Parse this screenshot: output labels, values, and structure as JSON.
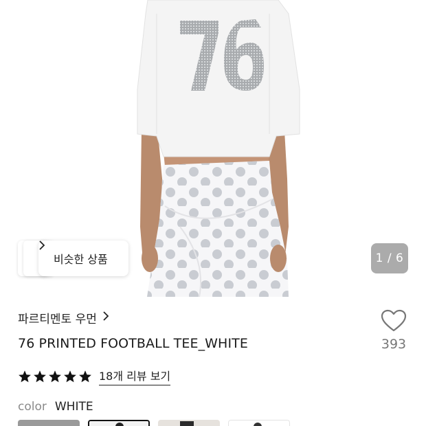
{
  "product_image": {
    "jersey_number": "76"
  },
  "similar": {
    "label": "비슷한 상품",
    "chevron": "chevron-right-icon"
  },
  "gallery": {
    "counter": "1 / 6"
  },
  "product": {
    "brand": "파르티멘토 우먼",
    "title": "76 PRINTED FOOTBALL TEE_WHITE"
  },
  "like": {
    "icon": "heart-outline-icon",
    "count": "393"
  },
  "rating": {
    "stars": 5,
    "review_link": "18개 리뷰 보기"
  },
  "color": {
    "label": "color",
    "value": "WHITE"
  },
  "colors": {
    "star": "#111111",
    "counter_bg": "#7a7a7a",
    "heart_stroke": "#777777"
  },
  "swatches": [
    {
      "name": "gray",
      "color": "#9a9a9a",
      "selected": false
    },
    {
      "name": "white",
      "color": "#f2f2f2",
      "selected": true
    },
    {
      "name": "black-photo",
      "color": "#d8d4cf",
      "selected": false
    },
    {
      "name": "white-2",
      "color": "#ffffff",
      "selected": false
    }
  ]
}
